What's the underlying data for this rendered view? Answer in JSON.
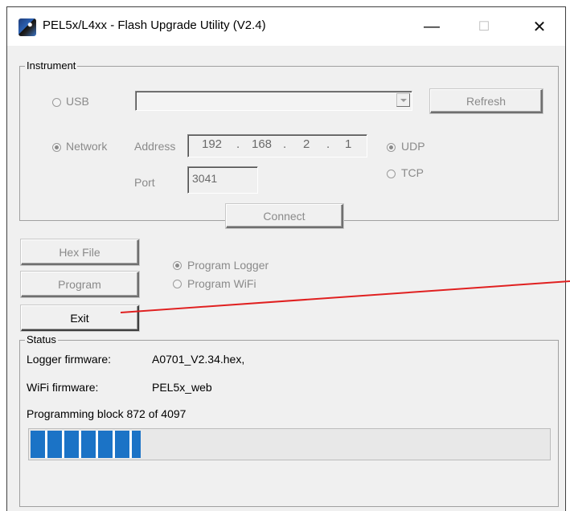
{
  "window": {
    "title": "PEL5x/L4xx - Flash Upgrade Utility (V2.4)",
    "minimize_glyph": "—",
    "maximize_glyph": "☐",
    "close_glyph": "✕",
    "app_icon": "utility-app-icon"
  },
  "instrument": {
    "group_label": "Instrument",
    "usb_label": "USB",
    "usb_selected": false,
    "usb_device_value": "",
    "refresh_label": "Refresh",
    "network_label": "Network",
    "network_selected": true,
    "address_label": "Address",
    "address_octets": [
      "192",
      "168",
      "2",
      "1"
    ],
    "address_separator": ".",
    "udp_label": "UDP",
    "udp_selected": true,
    "tcp_label": "TCP",
    "tcp_selected": false,
    "port_label": "Port",
    "port_value": "3041",
    "connect_label": "Connect"
  },
  "actions": {
    "hex_file_label": "Hex File",
    "program_label": "Program",
    "exit_label": "Exit",
    "program_logger_label": "Program Logger",
    "program_logger_selected": true,
    "program_wifi_label": "Program WiFi",
    "program_wifi_selected": false
  },
  "status": {
    "group_label": "Status",
    "logger_firmware_label": "Logger firmware:",
    "logger_firmware_value": "A0701_V2.34.hex,",
    "wifi_firmware_label": "WiFi firmware:",
    "wifi_firmware_value": "PEL5x_web",
    "progress_text": "Programming block 872 of 4097",
    "progress_fraction": 0.2128,
    "progress_color": "#1b73c6"
  },
  "annotation": {
    "arrow_color": "#e02020"
  }
}
